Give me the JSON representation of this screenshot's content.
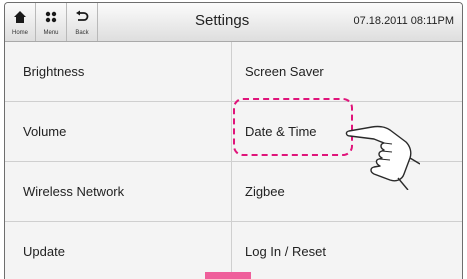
{
  "header": {
    "nav": [
      {
        "label": "Home"
      },
      {
        "label": "Menu"
      },
      {
        "label": "Back"
      }
    ],
    "title": "Settings",
    "datetime": "07.18.2011 08:11PM"
  },
  "items": {
    "left": [
      "Brightness",
      "Volume",
      "Wireless Network",
      "Update"
    ],
    "right": [
      "Screen Saver",
      "Date & Time",
      "Zigbee",
      "Log In / Reset"
    ]
  },
  "highlight_color": "#e0137a",
  "scroll_color": "#ef5f9b"
}
